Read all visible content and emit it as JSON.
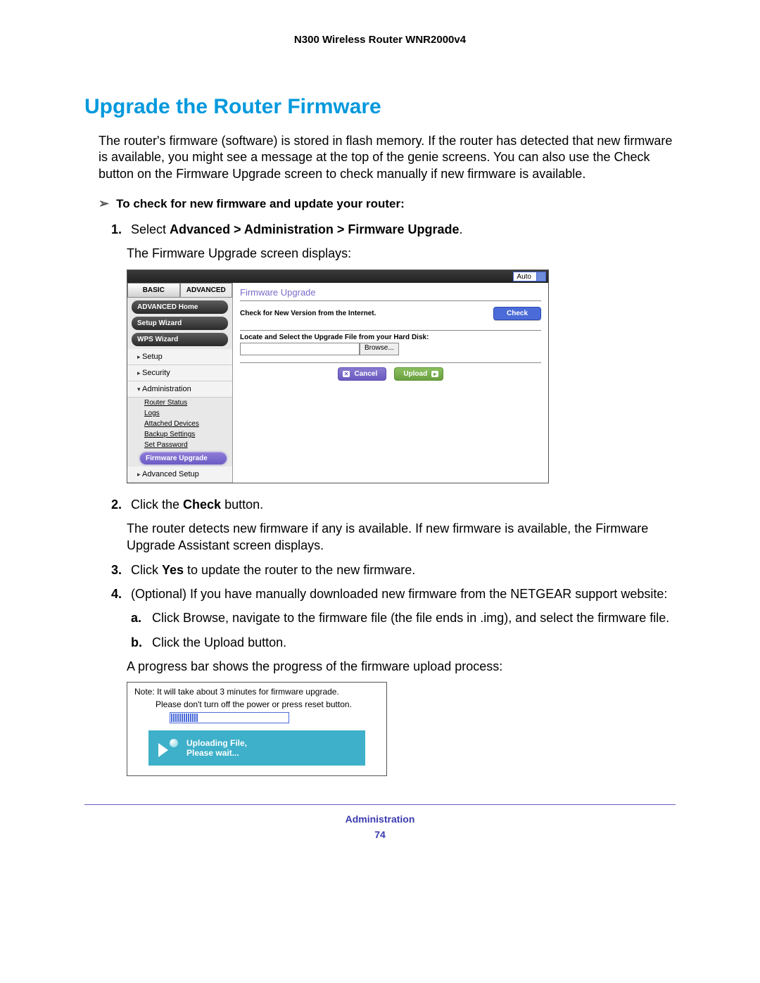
{
  "header": {
    "product": "N300 Wireless Router WNR2000v4"
  },
  "title": "Upgrade the Router Firmware",
  "intro": "The router's firmware (software) is stored in flash memory. If the router has detected that new firmware is available, you might see a message at the top of the genie screens. You can also use the Check button on the Firmware Upgrade screen to check manually if new firmware is available.",
  "task_heading": "To check for new firmware and update your router:",
  "step1a": "Select ",
  "step1b": "Advanced > Administration > Firmware Upgrade",
  "step1c": ".",
  "step1_desc": "The Firmware Upgrade screen displays:",
  "screenshot1": {
    "auto": "Auto",
    "tab_basic": "BASIC",
    "tab_advanced": "ADVANCED",
    "sidebar": {
      "home": "ADVANCED Home",
      "setup_wizard": "Setup Wizard",
      "wps_wizard": "WPS Wizard",
      "setup": "Setup",
      "security": "Security",
      "administration": "Administration",
      "subs": {
        "router_status": "Router Status",
        "logs": "Logs",
        "attached": "Attached Devices",
        "backup": "Backup Settings",
        "set_password": "Set Password",
        "firmware": "Firmware Upgrade"
      },
      "advanced_setup": "Advanced Setup"
    },
    "main": {
      "title": "Firmware Upgrade",
      "check_label": "Check for New Version from the Internet.",
      "check_btn": "Check",
      "locate_label": "Locate and Select the Upgrade File from your Hard Disk:",
      "browse_btn": "Browse...",
      "cancel_btn": "Cancel",
      "upload_btn": "Upload"
    }
  },
  "step2a": "Click the ",
  "step2b": "Check",
  "step2c": " button.",
  "step2_desc": "The router detects new firmware if any is available. If new firmware is available, the Firmware Upgrade Assistant screen displays.",
  "step3a": "Click ",
  "step3b": "Yes",
  "step3c": " to update the router to the new firmware.",
  "step4": "(Optional) If you have manually downloaded new firmware from the NETGEAR support website:",
  "step4a_a": "Click ",
  "step4a_b": "Browse",
  "step4a_c": ", navigate to the firmware file (the file ends in .img), and select the firmware file.",
  "step4b_a": "Click the ",
  "step4b_b": "Upload",
  "step4b_c": " button.",
  "step4_tail": "A progress bar shows the progress of the firmware upload process:",
  "screenshot2": {
    "note1": "Note: It will take about 3 minutes for firmware upgrade.",
    "note2": "Please don't turn off the power or press reset button.",
    "status1": "Uploading File,",
    "status2": "Please wait..."
  },
  "footer": {
    "section": "Administration",
    "page": "74"
  }
}
